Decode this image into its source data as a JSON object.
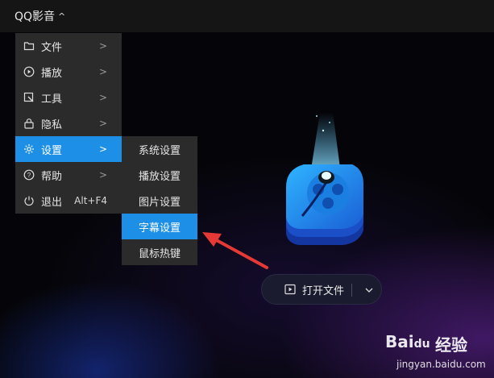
{
  "app": {
    "title": "QQ影音",
    "title_caret": "^"
  },
  "menu": {
    "items": [
      {
        "label": "文件",
        "icon": "folder-icon",
        "has_submenu": true
      },
      {
        "label": "播放",
        "icon": "play-circle-icon",
        "has_submenu": true
      },
      {
        "label": "工具",
        "icon": "tools-icon",
        "has_submenu": true
      },
      {
        "label": "隐私",
        "icon": "lock-icon",
        "has_submenu": true
      },
      {
        "label": "设置",
        "icon": "gear-icon",
        "has_submenu": true,
        "active": true
      },
      {
        "label": "帮助",
        "icon": "help-icon",
        "has_submenu": true
      },
      {
        "label": "退出",
        "icon": "power-icon",
        "shortcut": "Alt+F4"
      }
    ],
    "arrow_glyph": ">"
  },
  "submenu": {
    "items": [
      {
        "label": "系统设置"
      },
      {
        "label": "播放设置"
      },
      {
        "label": "图片设置"
      },
      {
        "label": "字幕设置",
        "active": true
      },
      {
        "label": "鼠标热键"
      }
    ]
  },
  "open_file": {
    "label": "打开文件",
    "icon": "play-file-icon",
    "dropdown_icon": "chevron-down-icon"
  },
  "watermark": {
    "brand": "Bai",
    "paw": "du",
    "product": "经验",
    "url": "jingyan.baidu.com"
  },
  "colors": {
    "accent": "#1e8fe6",
    "menu_bg": "#2b2b2b",
    "annotation": "#e53935"
  }
}
